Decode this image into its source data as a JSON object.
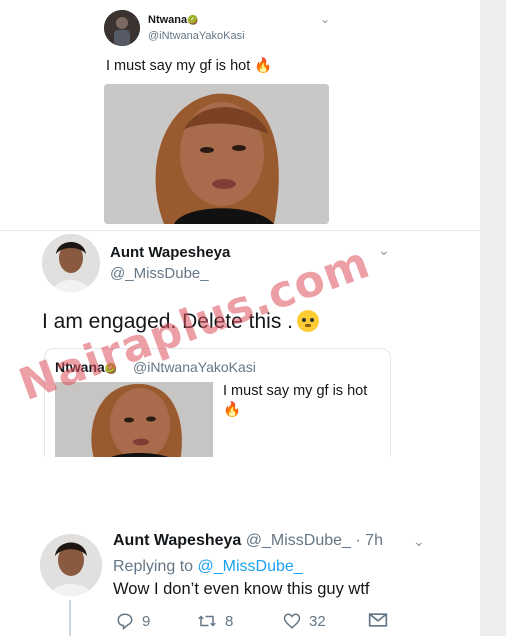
{
  "tweet1": {
    "name": "Ntwana",
    "name_badge": "🥝",
    "handle": "@iNtwanaYakoKasi",
    "text": "I must say my gf is hot",
    "emoji": "🔥"
  },
  "tweet2": {
    "name": "Aunt Wapesheya",
    "handle": "@_MissDube_",
    "text": "I am engaged. Delete this ."
  },
  "quote": {
    "name": "Ntwana",
    "name_badge": "🥝",
    "handle": "@iNtwanaYakoKasi",
    "text": "I must say my gf is hot",
    "emoji": "🔥"
  },
  "watermark": "Nairaplus.com",
  "reply": {
    "name": "Aunt Wapesheya",
    "handle": "@_MissDube_",
    "dot": " · ",
    "time": "7h",
    "replying_prefix": "Replying to ",
    "replying_handle": "@_MissDube_",
    "text": "Wow I don’t even know this guy wtf",
    "counts": {
      "replies": "9",
      "retweets": "8",
      "likes": "32"
    }
  },
  "icons": [
    "chevron-down-icon",
    "fire-icon",
    "flushed-face-icon",
    "reply-icon",
    "retweet-icon",
    "heart-icon",
    "envelope-icon"
  ]
}
